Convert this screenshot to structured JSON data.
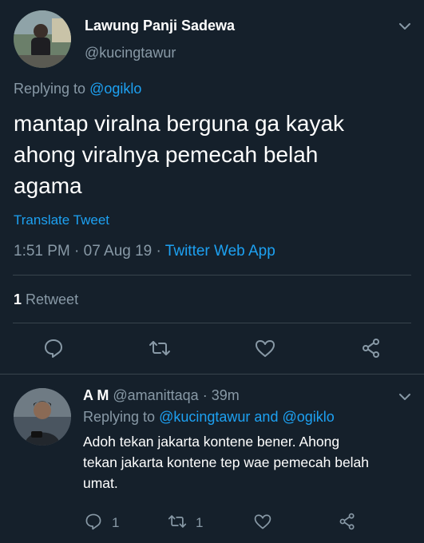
{
  "main_tweet": {
    "author_name": "Lawung Panji Sadewa",
    "author_handle": "@kucingtawur",
    "replying_prefix": "Replying to",
    "replying_to": "@ogiklo",
    "text_line1": "mantap viralna berguna ga kayak",
    "text_line2": "ahong viralnya pemecah belah",
    "text_line3": "agama",
    "translate_label": "Translate Tweet",
    "time": "1:51 PM",
    "date": "07 Aug 19",
    "source": "Twitter Web App",
    "sep": "·",
    "retweet_count": "1",
    "retweet_label": "Retweet"
  },
  "reply": {
    "author_name": "A M",
    "author_handle": "@amanittaqa",
    "age": "39m",
    "sep": "·",
    "replying_prefix": "Replying to",
    "replying_to_1": "@kucingtawur",
    "and_word": "and",
    "replying_to_2": "@ogiklo",
    "text_line1": "Adoh tekan jakarta kontene bener. Ahong",
    "text_line2": "tekan jakarta kontene tep wae pemecah belah",
    "text_line3": "umat.",
    "reply_count": "1",
    "retweet_count": "1"
  },
  "colors": {
    "background": "#15202b",
    "accent": "#1da1f2",
    "muted": "#8899a6",
    "divider": "#38444d"
  },
  "icons": [
    "reply-icon",
    "retweet-icon",
    "like-icon",
    "share-icon",
    "chevron-down-icon"
  ]
}
